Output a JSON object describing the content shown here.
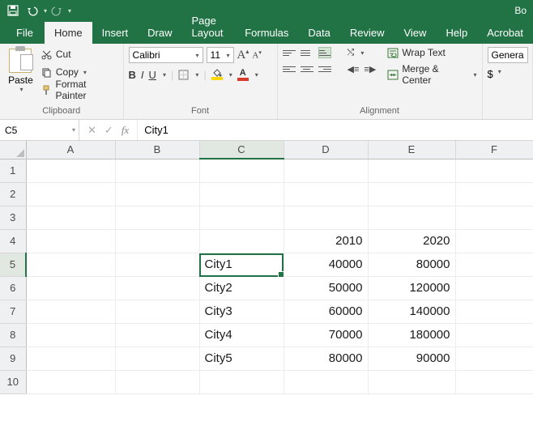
{
  "titlebar": {
    "doc_indicator": "Bo"
  },
  "tabs": {
    "file": "File",
    "home": "Home",
    "insert": "Insert",
    "draw": "Draw",
    "page_layout": "Page Layout",
    "formulas": "Formulas",
    "data": "Data",
    "review": "Review",
    "view": "View",
    "help": "Help",
    "acrobat": "Acrobat"
  },
  "ribbon": {
    "clipboard": {
      "paste": "Paste",
      "cut": "Cut",
      "copy": "Copy",
      "format_painter": "Format Painter",
      "label": "Clipboard"
    },
    "font": {
      "name": "Calibri",
      "size": "11",
      "bold": "B",
      "italic": "I",
      "underline": "U",
      "font_label_A_fill": "A",
      "font_label_A_color": "A",
      "label": "Font"
    },
    "alignment": {
      "wrap": "Wrap Text",
      "merge": "Merge & Center",
      "label": "Alignment"
    },
    "number": {
      "format": "Genera",
      "currency": "$"
    }
  },
  "formula_bar": {
    "name_box": "C5",
    "formula": "City1"
  },
  "grid": {
    "columns": [
      "A",
      "B",
      "C",
      "D",
      "E",
      "F"
    ],
    "rows": [
      "1",
      "2",
      "3",
      "4",
      "5",
      "6",
      "7",
      "8",
      "9",
      "10"
    ],
    "selected_col": "C",
    "selected_row": "5",
    "cells": {
      "D4": "2010",
      "E4": "2020",
      "C5": "City1",
      "D5": "40000",
      "E5": "80000",
      "C6": "City2",
      "D6": "50000",
      "E6": "120000",
      "C7": "City3",
      "D7": "60000",
      "E7": "140000",
      "C8": "City4",
      "D8": "70000",
      "E8": "180000",
      "C9": "City5",
      "D9": "80000",
      "E9": "90000"
    }
  },
  "chart_data": {
    "type": "table",
    "categories": [
      "City1",
      "City2",
      "City3",
      "City4",
      "City5"
    ],
    "series": [
      {
        "name": "2010",
        "values": [
          40000,
          50000,
          60000,
          70000,
          80000
        ]
      },
      {
        "name": "2020",
        "values": [
          80000,
          120000,
          140000,
          180000,
          90000
        ]
      }
    ]
  }
}
